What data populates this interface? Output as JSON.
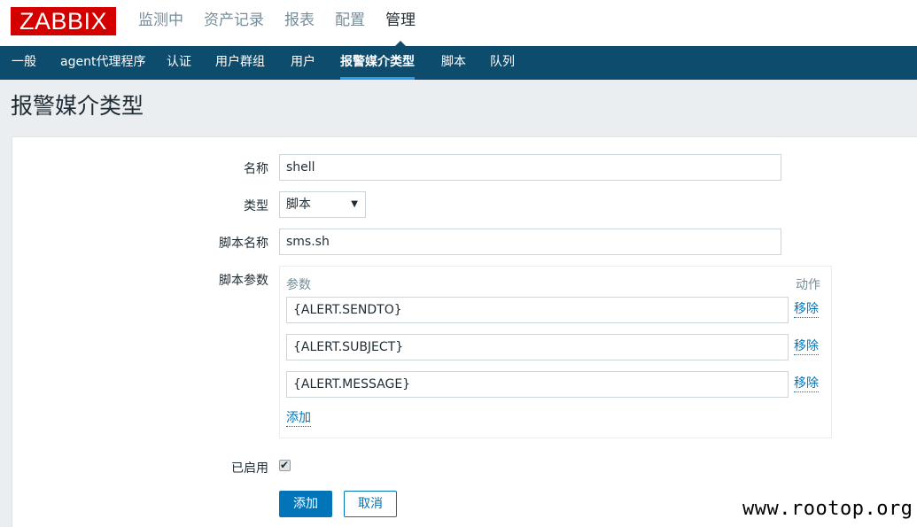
{
  "app": {
    "logo": "ZABBIX"
  },
  "top_nav": [
    {
      "label": "监测中"
    },
    {
      "label": "资产记录"
    },
    {
      "label": "报表"
    },
    {
      "label": "配置"
    },
    {
      "label": "管理",
      "active": true
    }
  ],
  "sub_nav": [
    {
      "label": "一般"
    },
    {
      "label": "agent代理程序"
    },
    {
      "label": "认证"
    },
    {
      "label": "用户群组"
    },
    {
      "label": "用户"
    },
    {
      "label": "报警媒介类型",
      "active": true
    },
    {
      "label": "脚本"
    },
    {
      "label": "队列"
    }
  ],
  "page": {
    "title": "报警媒介类型"
  },
  "form": {
    "name_label": "名称",
    "name_value": "shell",
    "type_label": "类型",
    "type_value": "脚本",
    "script_name_label": "脚本名称",
    "script_name_value": "sms.sh",
    "params_label": "脚本参数",
    "params": {
      "col_param": "参数",
      "col_action": "动作",
      "rows": [
        {
          "value": "{ALERT.SENDTO}",
          "remove": "移除"
        },
        {
          "value": "{ALERT.SUBJECT}",
          "remove": "移除"
        },
        {
          "value": "{ALERT.MESSAGE}",
          "remove": "移除"
        }
      ],
      "add_link": "添加"
    },
    "enabled_label": "已启用",
    "enabled_checked": true,
    "check_glyph": "✔",
    "add_button": "添加",
    "cancel_button": "取消"
  },
  "watermark": "www.rootop.org",
  "colors": {
    "brand": "#d40000",
    "nav_bg": "#0e4c6e",
    "primary": "#0275b8"
  }
}
